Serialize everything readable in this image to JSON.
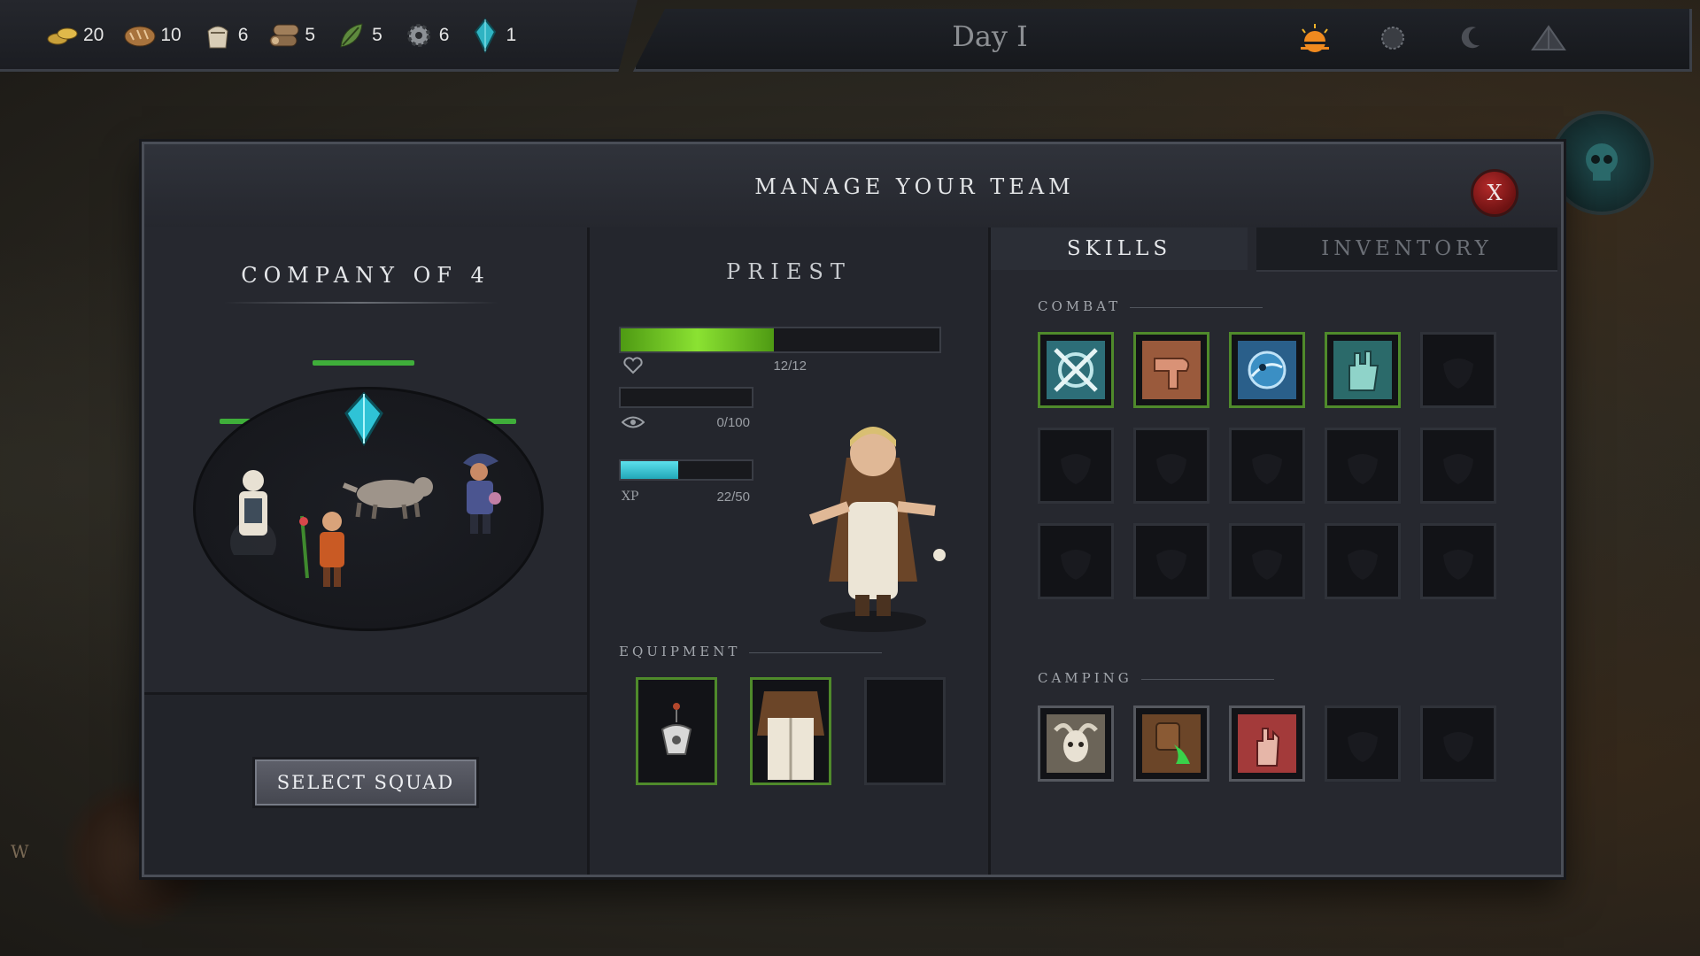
{
  "resources": [
    {
      "name": "gold-coins-icon",
      "value": "20"
    },
    {
      "name": "bread-icon",
      "value": "10"
    },
    {
      "name": "flour-sack-icon",
      "value": "6"
    },
    {
      "name": "wood-logs-icon",
      "value": "5"
    },
    {
      "name": "herb-leaf-icon",
      "value": "5"
    },
    {
      "name": "gear-icon",
      "value": "6"
    },
    {
      "name": "crystal-icon",
      "value": "1"
    }
  ],
  "day_title": "Day I",
  "time_icons": [
    "sunrise-icon",
    "sun-icon",
    "moon-icon",
    "tent-icon"
  ],
  "panel": {
    "title": "MANAGE YOUR TEAM",
    "close_label": "X"
  },
  "company": {
    "title": "COMPANY OF 4",
    "select_label": "SELECT SQUAD"
  },
  "hero": {
    "class_name": "PRIEST",
    "health": {
      "current": 12,
      "max": 12,
      "text": "12/12"
    },
    "awareness": {
      "current": 0,
      "max": 100,
      "text": "0/100"
    },
    "xp": {
      "label": "XP",
      "current": 22,
      "max": 50,
      "text": "22/50"
    },
    "equipment_label": "EQUIPMENT",
    "equipment": [
      "amulet",
      "robe",
      ""
    ]
  },
  "tabs": {
    "skills": "SKILLS",
    "inventory": "INVENTORY"
  },
  "skills": {
    "combat_label": "COMBAT",
    "combat": [
      "crossed-swords-shield-icon",
      "pointing-hand-icon",
      "water-orb-icon",
      "healing-hand-icon",
      "",
      "",
      "",
      "",
      "",
      "",
      "",
      "",
      "",
      "",
      ""
    ],
    "camping_label": "CAMPING",
    "camping": [
      "goat-skull-icon",
      "poison-potion-icon",
      "hand-gesture-icon",
      "",
      ""
    ]
  },
  "colors": {
    "health": "#6fd11f",
    "xp": "#2ec4d6",
    "skill_border": "#4f8a2b",
    "close": "#a32222"
  }
}
